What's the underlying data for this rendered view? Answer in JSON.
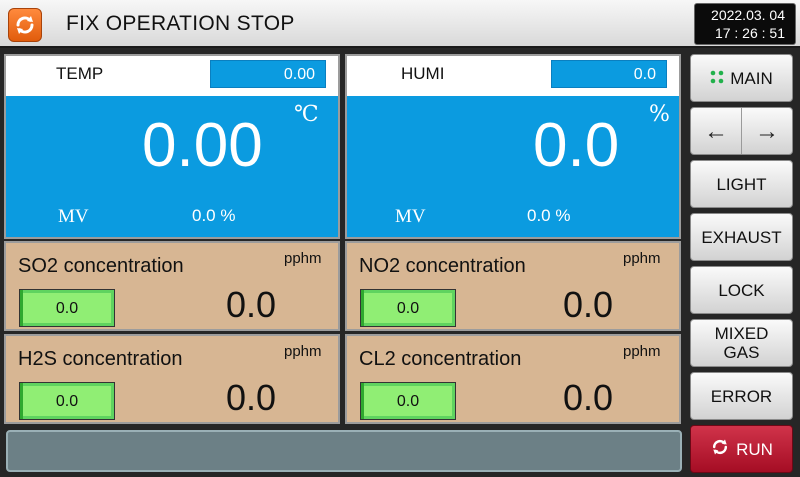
{
  "header": {
    "title": "FIX OPERATION STOP",
    "date": "2022.03. 04",
    "time": "17 : 26 : 51"
  },
  "temp": {
    "label": "TEMP",
    "sv": "0.00",
    "pv": "0.00",
    "unit": "℃",
    "mv_label": "MV",
    "mv_value": "0.0 %"
  },
  "humi": {
    "label": "HUMI",
    "sv": "0.0",
    "pv": "0.0",
    "unit": "%",
    "mv_label": "MV",
    "mv_value": "0.0 %"
  },
  "gases": [
    {
      "name": "SO2 concentration",
      "unit": "pphm",
      "setpoint": "0.0",
      "value": "0.0"
    },
    {
      "name": "NO2 concentration",
      "unit": "pphm",
      "setpoint": "0.0",
      "value": "0.0"
    },
    {
      "name": "H2S concentration",
      "unit": "pphm",
      "setpoint": "0.0",
      "value": "0.0"
    },
    {
      "name": "CL2 concentration",
      "unit": "pphm",
      "setpoint": "0.0",
      "value": "0.0"
    }
  ],
  "buttons": {
    "main": "MAIN",
    "arrow_left": "←",
    "arrow_right": "→",
    "light": "LIGHT",
    "exhaust": "EXHAUST",
    "lock": "LOCK",
    "mixed_gas_1": "MIXED",
    "mixed_gas_2": "GAS",
    "error": "ERROR",
    "run": "RUN"
  },
  "status_bar": {
    "message": ""
  },
  "colors": {
    "panel_blue": "#0b9be0",
    "gas_panel": "#d7b693",
    "setpoint_green": "#90ee74",
    "run_red": "#b81a31",
    "header_icon": "#f26b1d"
  },
  "icons": {
    "header": "refresh-icon",
    "main": "grid-dots-icon",
    "run": "refresh-icon"
  }
}
